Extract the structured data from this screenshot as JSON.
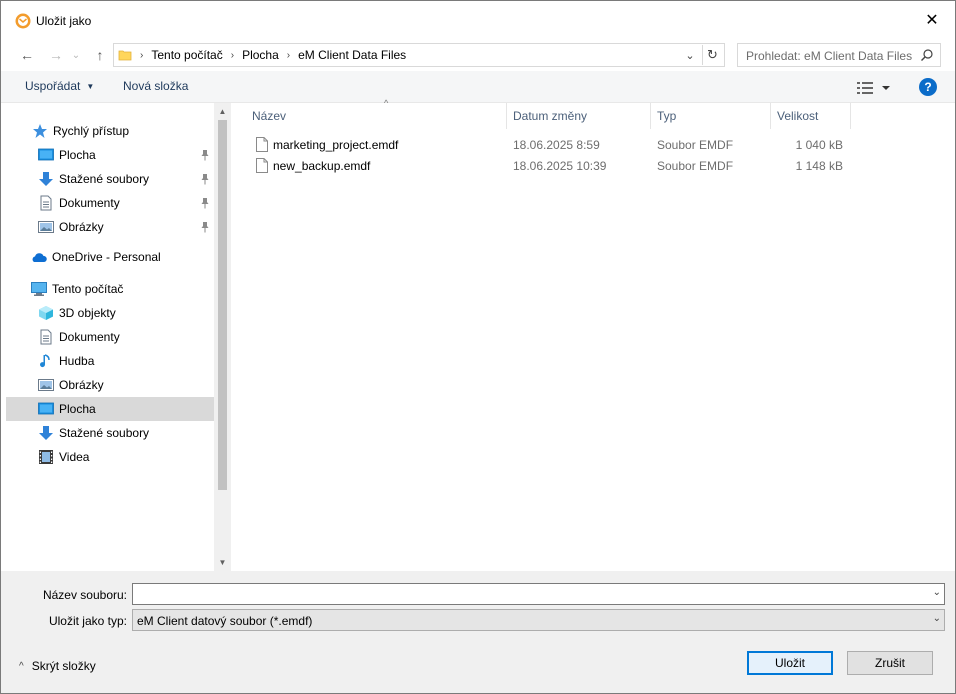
{
  "window": {
    "title": "Uložit jako",
    "close_glyph": "✕"
  },
  "nav": {
    "back_glyph": "←",
    "forward_glyph": "→",
    "recent_glyph": "⌄",
    "up_glyph": "↑",
    "breadcrumbs": [
      "Tento počítač",
      "Plocha",
      "eM Client Data Files"
    ],
    "dropdown_glyph": "⌄",
    "refresh_glyph": "↻",
    "search_placeholder": "Prohledat: eM Client Data Files"
  },
  "toolbar": {
    "organize_label": "Uspořádat",
    "new_folder_label": "Nová složka",
    "help_label": "?"
  },
  "sidebar": {
    "quick_access": {
      "label": "Rychlý přístup",
      "items": [
        {
          "label": "Plocha",
          "icon": "desktop-icon",
          "pinned": true
        },
        {
          "label": "Stažené soubory",
          "icon": "download-icon",
          "pinned": true
        },
        {
          "label": "Dokumenty",
          "icon": "documents-icon",
          "pinned": true
        },
        {
          "label": "Obrázky",
          "icon": "pictures-icon",
          "pinned": true
        }
      ]
    },
    "onedrive": {
      "label": "OneDrive - Personal",
      "icon": "onedrive-icon"
    },
    "this_pc": {
      "label": "Tento počítač",
      "items": [
        {
          "label": "3D objekty",
          "icon": "3d-objects-icon"
        },
        {
          "label": "Dokumenty",
          "icon": "documents-icon"
        },
        {
          "label": "Hudba",
          "icon": "music-icon"
        },
        {
          "label": "Obrázky",
          "icon": "pictures-icon"
        },
        {
          "label": "Plocha",
          "icon": "desktop-icon",
          "selected": true
        },
        {
          "label": "Stažené soubory",
          "icon": "download-icon"
        },
        {
          "label": "Videa",
          "icon": "videos-icon"
        }
      ]
    }
  },
  "file_list": {
    "columns": [
      "Název",
      "Datum změny",
      "Typ",
      "Velikost"
    ],
    "sort_glyph": "^",
    "rows": [
      {
        "name": "marketing_project.emdf",
        "date": "18.06.2025 8:59",
        "type": "Soubor EMDF",
        "size": "1 040 kB"
      },
      {
        "name": "new_backup.emdf",
        "date": "18.06.2025 10:39",
        "type": "Soubor EMDF",
        "size": "1 148 kB"
      }
    ]
  },
  "form": {
    "filename_label": "Název souboru:",
    "filename_value": "",
    "filetype_label": "Uložit jako typ:",
    "filetype_value": "eM Client datový soubor (*.emdf)",
    "dropdown_glyph": "⌄",
    "hide_folders_label": "Skrýt složky",
    "hide_folders_glyph": "^",
    "save_label": "Uložit",
    "cancel_label": "Zrušit"
  },
  "colors": {
    "accent": "#0078d7",
    "selection": "#d9d9d9",
    "toolbar_bg": "#f5f6f7",
    "footer_bg": "#f0f0f0",
    "link_text": "#1e395b"
  }
}
